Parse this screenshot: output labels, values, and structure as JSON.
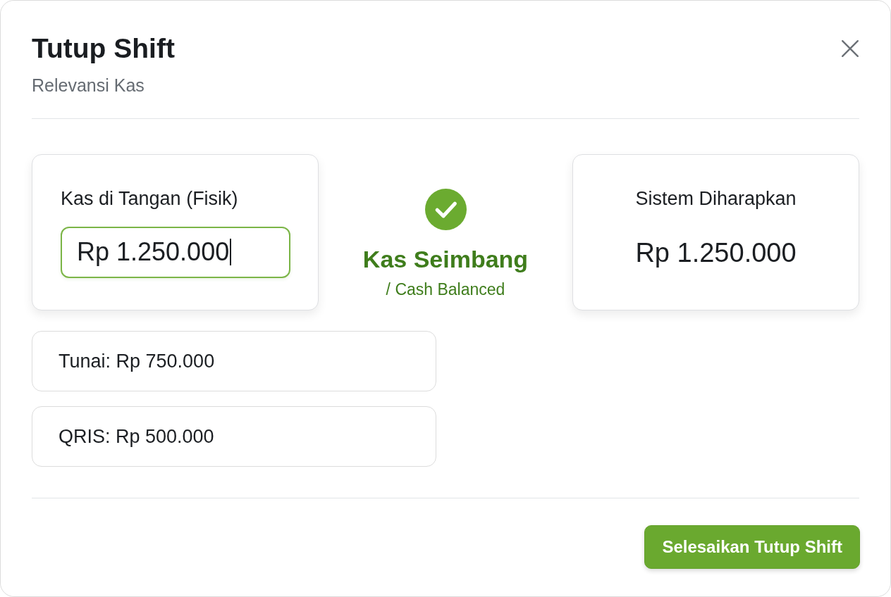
{
  "dialog": {
    "title": "Tutup Shift",
    "subtitle": "Relevansi Kas"
  },
  "physical_cash": {
    "label": "Kas di Tangan (Fisik)",
    "input": {
      "value": "Rp 1.250.000",
      "focused": true
    }
  },
  "status": {
    "kind": "balanced",
    "title": "Kas Seimbang",
    "subtitle": "/ Cash Balanced"
  },
  "expected": {
    "label": "Sistem Diharapkan",
    "value": "Rp 1.250.000"
  },
  "breakdown": [
    "Tunai: Rp 750.000",
    "QRIS: Rp 500.000"
  ],
  "buttons": [
    {
      "label": "Selesaikan Tutup Shift",
      "kind": "primary"
    }
  ]
}
